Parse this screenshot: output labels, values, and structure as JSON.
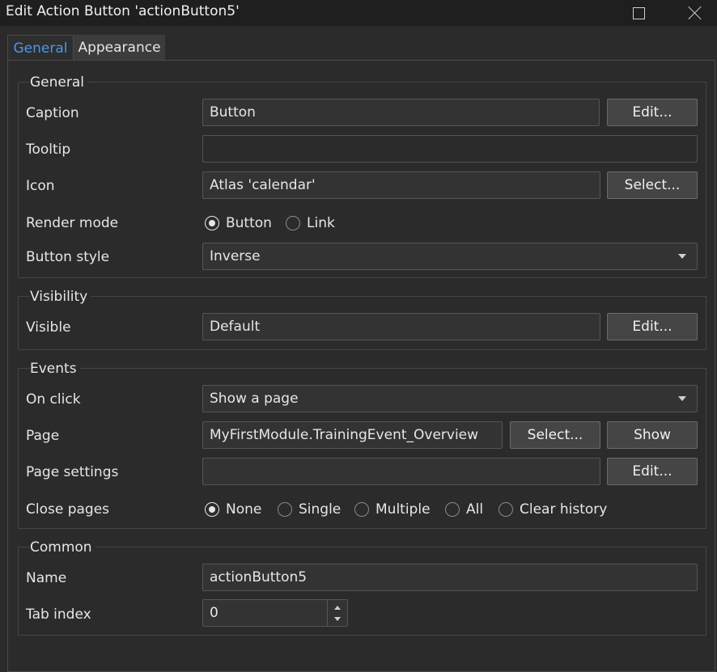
{
  "window": {
    "title": "Edit Action Button 'actionButton5'"
  },
  "tabs": {
    "general": "General",
    "appearance": "Appearance"
  },
  "general": {
    "title": "General",
    "caption_label": "Caption",
    "caption_value": "Button",
    "caption_edit": "Edit...",
    "tooltip_label": "Tooltip",
    "tooltip_value": "",
    "icon_label": "Icon",
    "icon_value": "Atlas 'calendar'",
    "icon_select": "Select...",
    "render_mode_label": "Render mode",
    "render_mode_options": [
      "Button",
      "Link"
    ],
    "render_mode_selected": "Button",
    "button_style_label": "Button style",
    "button_style_value": "Inverse"
  },
  "visibility": {
    "title": "Visibility",
    "visible_label": "Visible",
    "visible_value": "Default",
    "visible_edit": "Edit..."
  },
  "events": {
    "title": "Events",
    "on_click_label": "On click",
    "on_click_value": "Show a page",
    "page_label": "Page",
    "page_value": "MyFirstModule.TrainingEvent_Overview",
    "page_select": "Select...",
    "page_show": "Show",
    "page_settings_label": "Page settings",
    "page_settings_value": "",
    "page_settings_edit": "Edit...",
    "close_pages_label": "Close pages",
    "close_pages_options": [
      "None",
      "Single",
      "Multiple",
      "All",
      "Clear history"
    ],
    "close_pages_selected": "None"
  },
  "common": {
    "title": "Common",
    "name_label": "Name",
    "name_value": "actionButton5",
    "tab_index_label": "Tab index",
    "tab_index_value": "0"
  },
  "colors": {
    "accent": "#4d96e8",
    "background": "#2b2b2b",
    "titlebar": "#1f1f1f",
    "button": "#454545"
  }
}
